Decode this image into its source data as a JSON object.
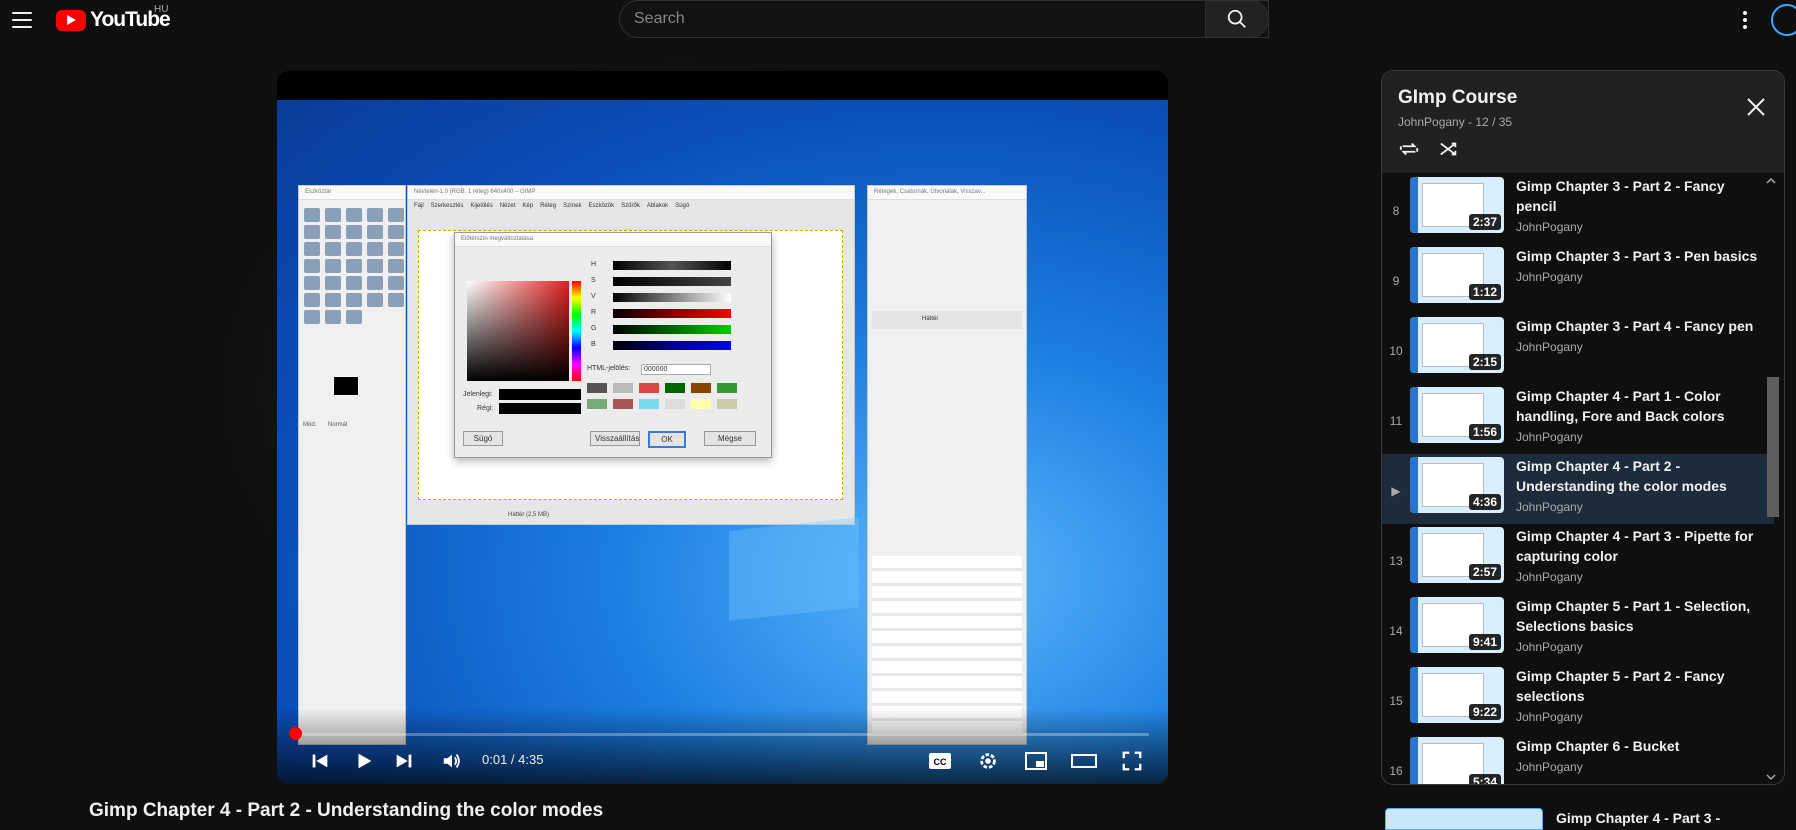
{
  "header": {
    "menu_icon": "hamburger-menu-icon",
    "logo_text": "YouTube",
    "region": "HU",
    "search_placeholder": "Search",
    "search_icon": "search-icon",
    "more_icon": "more-vert-icon",
    "account_icon": "account-avatar-icon"
  },
  "player": {
    "time_current": "0:01",
    "time_total": "4:35",
    "time_display": "0:01 / 4:35",
    "progress": 0.004,
    "gimp_windows": {
      "toolbox_title": "Eszköztár",
      "canvas_title": "Névtelen-1.0 (RGB, 1 réteg) 640x400 – GIMP",
      "menubar": [
        "Fájl",
        "Szerkesztés",
        "Kijelölés",
        "Nézet",
        "Kép",
        "Réteg",
        "Színek",
        "Eszközök",
        "Szűrők",
        "Ablakok",
        "Súgó"
      ],
      "dialog_title": "Előtérszín megváltoztatása",
      "channels": [
        "H",
        "S",
        "V",
        "R",
        "G",
        "B"
      ],
      "html_label": "HTML-jelölés:",
      "html_value": "000000",
      "current_label": "Jelenlegi:",
      "old_label": "Régi:",
      "btn_help": "Súgó",
      "btn_reset": "Visszaállítás",
      "btn_ok": "OK",
      "btn_cancel": "Mégse",
      "layers_title": "Rétegek, Csatornák, Útvonalak, Visszav...",
      "layer_name": "Háttér",
      "mode_label": "Mód:",
      "mode_value": "Normál",
      "status": "Háttér (2,5 MB)"
    },
    "icons": [
      "previous-icon",
      "play-icon",
      "next-icon",
      "volume-icon",
      "captions-icon",
      "settings-icon",
      "miniplayer-icon",
      "theater-icon",
      "fullscreen-icon"
    ],
    "colors": {
      "progress": "#ff0000"
    }
  },
  "video": {
    "title": "Gimp Chapter 4 - Part 2 - Understanding the color modes"
  },
  "playlist": {
    "title": "GImp Course",
    "subtitle": "JohnPogany - 12 / 35",
    "close_icon": "close-icon",
    "loop_icon": "loop-icon",
    "shuffle_icon": "shuffle-icon",
    "items": [
      {
        "index": "8",
        "title": "Gimp Chapter 3 - Part 2 - Fancy pencil",
        "author": "JohnPogany",
        "duration": "2:37",
        "active": false
      },
      {
        "index": "9",
        "title": "Gimp Chapter 3 - Part 3 - Pen basics",
        "author": "JohnPogany",
        "duration": "1:12",
        "active": false
      },
      {
        "index": "10",
        "title": "Gimp Chapter 3 - Part 4 - Fancy pen",
        "author": "JohnPogany",
        "duration": "2:15",
        "active": false
      },
      {
        "index": "11",
        "title": "Gimp Chapter 4 - Part 1 - Color handling, Fore and Back colors",
        "author": "JohnPogany",
        "duration": "1:56",
        "active": false
      },
      {
        "index": "▶",
        "title": "Gimp Chapter 4 - Part 2 - Understanding the color modes",
        "author": "JohnPogany",
        "duration": "4:36",
        "active": true
      },
      {
        "index": "13",
        "title": "Gimp Chapter 4 - Part 3 - Pipette for capturing color",
        "author": "JohnPogany",
        "duration": "2:57",
        "active": false
      },
      {
        "index": "14",
        "title": "Gimp Chapter 5 - Part 1 - Selection, Selections basics",
        "author": "JohnPogany",
        "duration": "9:41",
        "active": false
      },
      {
        "index": "15",
        "title": "Gimp Chapter 5 - Part 2 - Fancy selections",
        "author": "JohnPogany",
        "duration": "9:22",
        "active": false
      },
      {
        "index": "16",
        "title": "Gimp Chapter 6 - Bucket",
        "author": "JohnPogany",
        "duration": "5:34",
        "active": false
      }
    ]
  },
  "next_video": {
    "title": "Gimp Chapter 4 - Part 3 -"
  }
}
